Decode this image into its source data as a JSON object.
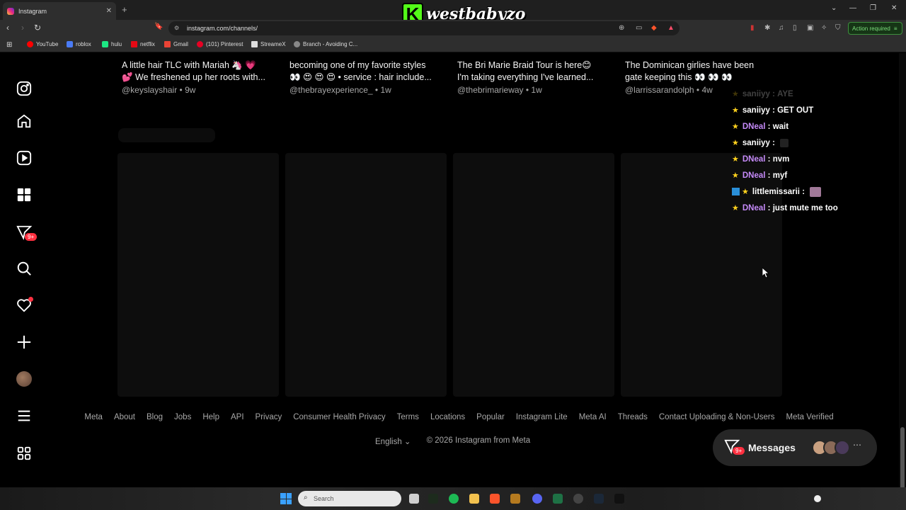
{
  "browser": {
    "tab_title": "Instagram",
    "url": "instagram.com/channels/",
    "action_required": "Action required",
    "bookmarks": [
      "YouTube",
      "roblox",
      "hulu",
      "Gmail",
      "(101) Pinterest",
      "StreameX",
      "Branch - Avoiding C..."
    ],
    "bookmark_netflix": "netflix"
  },
  "overlay": {
    "brand_letter": "K",
    "brand_name": "westbabyzo"
  },
  "cards": [
    {
      "title_line1": "A little hair TLC with Mariah 🦄 💗",
      "title_line2": "💕 We freshened up her roots with...",
      "author": "@keyslayshair",
      "age": "9w"
    },
    {
      "title_line1": "becoming one of my favorite styles",
      "title_line2": "👀 😍 😍 😍 • service : hair include...",
      "author": "@thebrayexperience_",
      "age": "1w"
    },
    {
      "title_line1": "The Bri Marie Braid Tour is here😊",
      "title_line2": "I'm taking everything I've learned...",
      "author": "@thebrimarieway",
      "age": "1w"
    },
    {
      "title_line1": "The Dominican girlies have been",
      "title_line2": "gate keeping this 👀 👀 👀",
      "author": "@larrissarandolph",
      "age": "4w"
    }
  ],
  "chat": [
    {
      "name": "saniiyy",
      "message": "AYE",
      "name_color": "white",
      "faded": true
    },
    {
      "name": "saniiyy",
      "message": "GET OUT",
      "name_color": "white",
      "faded": false
    },
    {
      "name": "DNeal",
      "message": "wait",
      "name_color": "purple",
      "faded": false
    },
    {
      "name": "saniiyy",
      "message": "",
      "name_color": "white",
      "faded": false
    },
    {
      "name": "DNeal",
      "message": "nvm",
      "name_color": "purple",
      "faded": false
    },
    {
      "name": "DNeal",
      "message": "myf",
      "name_color": "purple",
      "faded": false
    },
    {
      "name": "littlemissarii",
      "message": "",
      "name_color": "white",
      "faded": false
    },
    {
      "name": "DNeal",
      "message": "just mute me too",
      "name_color": "purple",
      "faded": false
    }
  ],
  "sidebar": {
    "notifications_badge": "9+"
  },
  "footer": {
    "links": [
      "Meta",
      "About",
      "Blog",
      "Jobs",
      "Help",
      "API",
      "Privacy",
      "Consumer Health Privacy",
      "Terms",
      "Locations",
      "Popular",
      "Instagram Lite",
      "Meta AI",
      "Threads",
      "Contact Uploading & Non-Users",
      "Meta Verified"
    ],
    "language": "English",
    "copyright": "© 2026 Instagram from Meta"
  },
  "messages": {
    "label": "Messages",
    "badge": "9+"
  },
  "taskbar": {
    "search_placeholder": "Search"
  },
  "colors": {
    "accent_red": "#ff3040",
    "kick_green": "#53fc18",
    "chat_purple": "#c58af9",
    "star_yellow": "#ffd21e"
  }
}
